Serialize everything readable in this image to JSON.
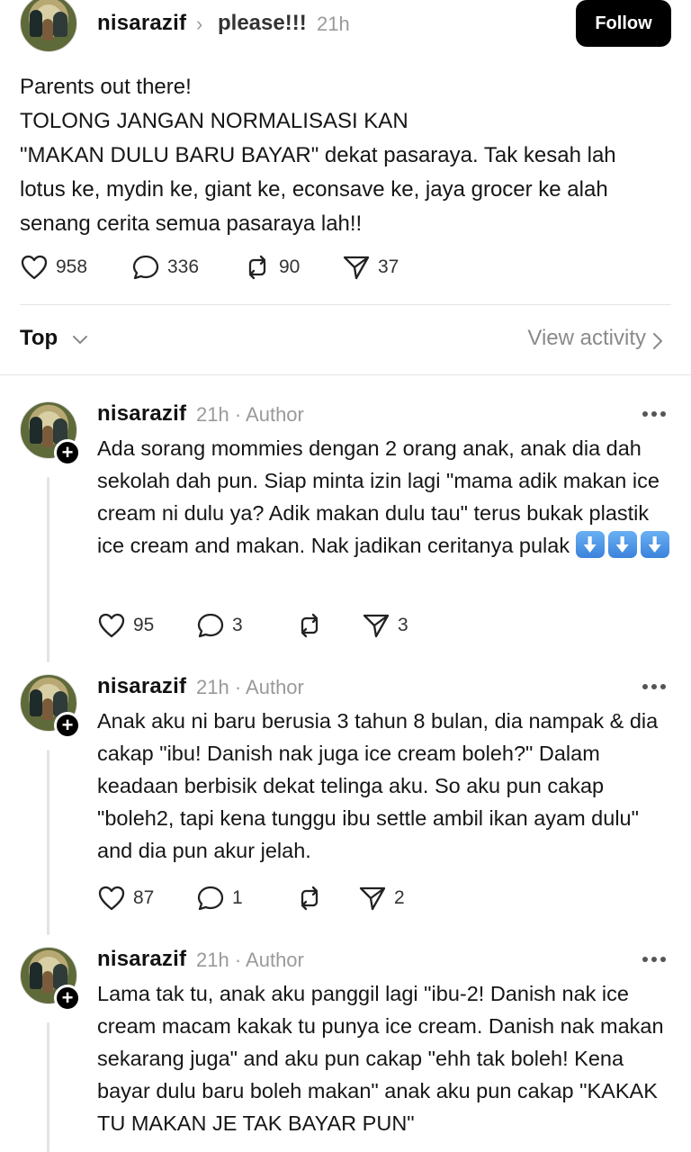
{
  "post": {
    "username": "nisarazif",
    "topic": "please!!!",
    "time": "21h",
    "follow_label": "Follow",
    "lines": [
      "Parents out there!",
      "TOLONG JANGAN NORMALISASI KAN",
      "\"MAKAN DULU BARU BAYAR\" dekat pasaraya. Tak kesah lah",
      "lotus ke, mydin ke, giant ke, econsave ke, jaya grocer ke alah",
      "senang cerita semua pasaraya lah!!"
    ],
    "likes": "958",
    "comments": "336",
    "reposts": "90",
    "shares": "37"
  },
  "sort": {
    "label": "Top",
    "view_activity": "View activity"
  },
  "replies": [
    {
      "username": "nisarazif",
      "meta": "21h · Author",
      "text": "Ada sorang mommies dengan 2 orang anak, anak dia dah sekolah dah pun. Siap minta izin lagi \"mama adik makan ice cream ni dulu ya? Adik makan dulu tau\" terus bukak plastik ice cream and makan. Nak jadikan ceritanya pulak",
      "emoji": [
        "arrow-down-emoji",
        "arrow-down-emoji",
        "arrow-down-emoji"
      ],
      "likes": "95",
      "comments": "3",
      "reposts": "",
      "shares": "3"
    },
    {
      "username": "nisarazif",
      "meta": "21h · Author",
      "text": "Anak aku ni baru berusia 3 tahun 8 bulan, dia nampak & dia cakap \"ibu! Danish nak juga ice cream boleh?\" Dalam keadaan berbisik dekat telinga aku. So aku pun cakap \"boleh2, tapi kena tunggu ibu settle ambil ikan ayam dulu\" and dia pun akur jelah.",
      "likes": "87",
      "comments": "1",
      "reposts": "",
      "shares": "2"
    },
    {
      "username": "nisarazif",
      "meta": "21h · Author",
      "text": "Lama tak tu, anak aku panggil lagi \"ibu-2! Danish nak ice cream macam kakak tu punya ice cream. Danish nak makan sekarang juga\" and aku pun cakap \"ehh tak boleh! Kena bayar dulu baru boleh makan\" anak aku pun cakap \"KAKAK TU MAKAN JE TAK BAYAR PUN\""
    }
  ]
}
